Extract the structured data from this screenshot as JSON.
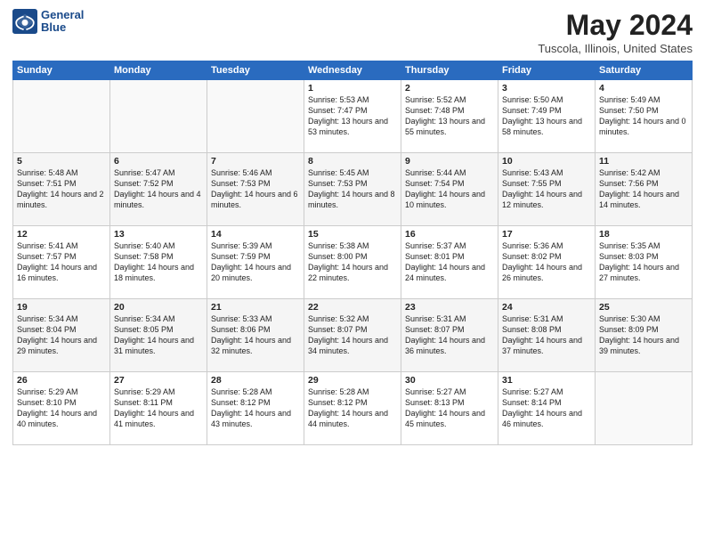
{
  "header": {
    "logo_line1": "General",
    "logo_line2": "Blue",
    "title": "May 2024",
    "location": "Tuscola, Illinois, United States"
  },
  "weekdays": [
    "Sunday",
    "Monday",
    "Tuesday",
    "Wednesday",
    "Thursday",
    "Friday",
    "Saturday"
  ],
  "weeks": [
    [
      {
        "day": "",
        "content": ""
      },
      {
        "day": "",
        "content": ""
      },
      {
        "day": "",
        "content": ""
      },
      {
        "day": "1",
        "content": "Sunrise: 5:53 AM\nSunset: 7:47 PM\nDaylight: 13 hours\nand 53 minutes."
      },
      {
        "day": "2",
        "content": "Sunrise: 5:52 AM\nSunset: 7:48 PM\nDaylight: 13 hours\nand 55 minutes."
      },
      {
        "day": "3",
        "content": "Sunrise: 5:50 AM\nSunset: 7:49 PM\nDaylight: 13 hours\nand 58 minutes."
      },
      {
        "day": "4",
        "content": "Sunrise: 5:49 AM\nSunset: 7:50 PM\nDaylight: 14 hours\nand 0 minutes."
      }
    ],
    [
      {
        "day": "5",
        "content": "Sunrise: 5:48 AM\nSunset: 7:51 PM\nDaylight: 14 hours\nand 2 minutes."
      },
      {
        "day": "6",
        "content": "Sunrise: 5:47 AM\nSunset: 7:52 PM\nDaylight: 14 hours\nand 4 minutes."
      },
      {
        "day": "7",
        "content": "Sunrise: 5:46 AM\nSunset: 7:53 PM\nDaylight: 14 hours\nand 6 minutes."
      },
      {
        "day": "8",
        "content": "Sunrise: 5:45 AM\nSunset: 7:53 PM\nDaylight: 14 hours\nand 8 minutes."
      },
      {
        "day": "9",
        "content": "Sunrise: 5:44 AM\nSunset: 7:54 PM\nDaylight: 14 hours\nand 10 minutes."
      },
      {
        "day": "10",
        "content": "Sunrise: 5:43 AM\nSunset: 7:55 PM\nDaylight: 14 hours\nand 12 minutes."
      },
      {
        "day": "11",
        "content": "Sunrise: 5:42 AM\nSunset: 7:56 PM\nDaylight: 14 hours\nand 14 minutes."
      }
    ],
    [
      {
        "day": "12",
        "content": "Sunrise: 5:41 AM\nSunset: 7:57 PM\nDaylight: 14 hours\nand 16 minutes."
      },
      {
        "day": "13",
        "content": "Sunrise: 5:40 AM\nSunset: 7:58 PM\nDaylight: 14 hours\nand 18 minutes."
      },
      {
        "day": "14",
        "content": "Sunrise: 5:39 AM\nSunset: 7:59 PM\nDaylight: 14 hours\nand 20 minutes."
      },
      {
        "day": "15",
        "content": "Sunrise: 5:38 AM\nSunset: 8:00 PM\nDaylight: 14 hours\nand 22 minutes."
      },
      {
        "day": "16",
        "content": "Sunrise: 5:37 AM\nSunset: 8:01 PM\nDaylight: 14 hours\nand 24 minutes."
      },
      {
        "day": "17",
        "content": "Sunrise: 5:36 AM\nSunset: 8:02 PM\nDaylight: 14 hours\nand 26 minutes."
      },
      {
        "day": "18",
        "content": "Sunrise: 5:35 AM\nSunset: 8:03 PM\nDaylight: 14 hours\nand 27 minutes."
      }
    ],
    [
      {
        "day": "19",
        "content": "Sunrise: 5:34 AM\nSunset: 8:04 PM\nDaylight: 14 hours\nand 29 minutes."
      },
      {
        "day": "20",
        "content": "Sunrise: 5:34 AM\nSunset: 8:05 PM\nDaylight: 14 hours\nand 31 minutes."
      },
      {
        "day": "21",
        "content": "Sunrise: 5:33 AM\nSunset: 8:06 PM\nDaylight: 14 hours\nand 32 minutes."
      },
      {
        "day": "22",
        "content": "Sunrise: 5:32 AM\nSunset: 8:07 PM\nDaylight: 14 hours\nand 34 minutes."
      },
      {
        "day": "23",
        "content": "Sunrise: 5:31 AM\nSunset: 8:07 PM\nDaylight: 14 hours\nand 36 minutes."
      },
      {
        "day": "24",
        "content": "Sunrise: 5:31 AM\nSunset: 8:08 PM\nDaylight: 14 hours\nand 37 minutes."
      },
      {
        "day": "25",
        "content": "Sunrise: 5:30 AM\nSunset: 8:09 PM\nDaylight: 14 hours\nand 39 minutes."
      }
    ],
    [
      {
        "day": "26",
        "content": "Sunrise: 5:29 AM\nSunset: 8:10 PM\nDaylight: 14 hours\nand 40 minutes."
      },
      {
        "day": "27",
        "content": "Sunrise: 5:29 AM\nSunset: 8:11 PM\nDaylight: 14 hours\nand 41 minutes."
      },
      {
        "day": "28",
        "content": "Sunrise: 5:28 AM\nSunset: 8:12 PM\nDaylight: 14 hours\nand 43 minutes."
      },
      {
        "day": "29",
        "content": "Sunrise: 5:28 AM\nSunset: 8:12 PM\nDaylight: 14 hours\nand 44 minutes."
      },
      {
        "day": "30",
        "content": "Sunrise: 5:27 AM\nSunset: 8:13 PM\nDaylight: 14 hours\nand 45 minutes."
      },
      {
        "day": "31",
        "content": "Sunrise: 5:27 AM\nSunset: 8:14 PM\nDaylight: 14 hours\nand 46 minutes."
      },
      {
        "day": "",
        "content": ""
      }
    ]
  ]
}
